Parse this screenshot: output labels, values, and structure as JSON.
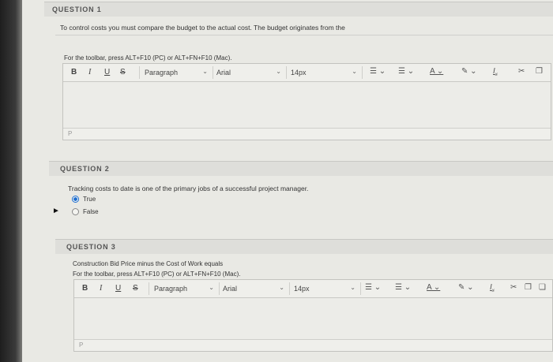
{
  "q1": {
    "header": "QUESTION 1",
    "prompt": "To control costs you must compare the budget to the actual cost. The budget originates from the",
    "toolbar_hint": "For the toolbar, press ALT+F10 (PC) or ALT+FN+F10 (Mac).",
    "status_path": "P"
  },
  "q2": {
    "header": "QUESTION 2",
    "prompt": "Tracking costs to date is one of the primary jobs of a successful project manager.",
    "options": [
      {
        "label": "True",
        "selected": true
      },
      {
        "label": "False",
        "selected": false
      }
    ]
  },
  "q3": {
    "header": "QUESTION 3",
    "prompt": "Construction Bid Price minus the Cost of Work equals",
    "toolbar_hint": "For the toolbar, press ALT+F10 (PC) or ALT+FN+F10 (Mac).",
    "status_path": "P"
  },
  "toolbar": {
    "bold": "B",
    "italic": "I",
    "underline": "U",
    "strike": "S",
    "paragraph": "Paragraph",
    "font": "Arial",
    "size": "14px",
    "icons": [
      "unordered-list-icon",
      "ordered-list-icon",
      "text-color-icon",
      "highlight-icon",
      "clear-format-icon",
      "cut-icon",
      "copy-icon",
      "paste-icon"
    ]
  },
  "colors": {
    "accent": "#1f6fd1",
    "background": "#e9e9e4"
  }
}
